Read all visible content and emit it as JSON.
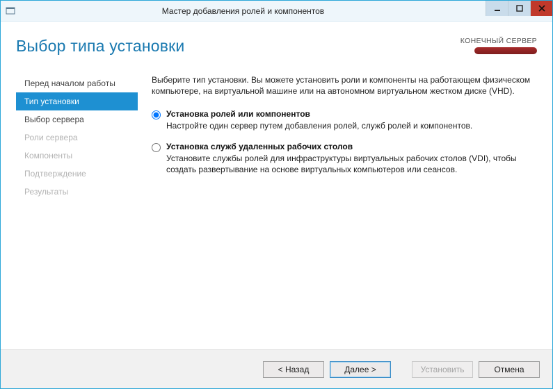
{
  "window": {
    "title": "Мастер добавления ролей и компонентов"
  },
  "header": {
    "page_title": "Выбор типа установки",
    "target_label": "КОНЕЧНЫЙ СЕРВЕР"
  },
  "sidebar": {
    "items": [
      {
        "label": "Перед началом работы",
        "state": "normal"
      },
      {
        "label": "Тип установки",
        "state": "active"
      },
      {
        "label": "Выбор сервера",
        "state": "normal"
      },
      {
        "label": "Роли сервера",
        "state": "disabled"
      },
      {
        "label": "Компоненты",
        "state": "disabled"
      },
      {
        "label": "Подтверждение",
        "state": "disabled"
      },
      {
        "label": "Результаты",
        "state": "disabled"
      }
    ]
  },
  "main": {
    "intro": "Выберите тип установки. Вы можете установить роли и компоненты на работающем физическом компьютере, на виртуальной машине или на автономном виртуальном жестком диске (VHD).",
    "options": [
      {
        "title": "Установка ролей или компонентов",
        "desc": "Настройте один сервер путем добавления ролей, служб ролей и компонентов.",
        "selected": true
      },
      {
        "title": "Установка служб удаленных рабочих столов",
        "desc": "Установите службы ролей для инфраструктуры виртуальных рабочих столов (VDI), чтобы создать развертывание на основе виртуальных компьютеров или сеансов.",
        "selected": false
      }
    ]
  },
  "footer": {
    "back": "< Назад",
    "next": "Далее >",
    "install": "Установить",
    "cancel": "Отмена"
  }
}
